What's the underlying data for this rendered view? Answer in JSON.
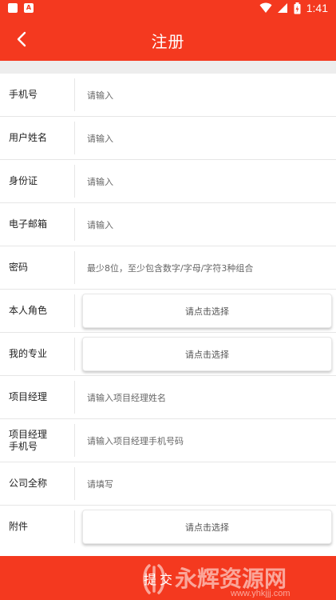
{
  "status_bar": {
    "time": "1:41",
    "left_icons": [
      "notification-icon",
      "a-icon"
    ],
    "right_icons": [
      "wifi-icon",
      "signal-icon",
      "battery-icon"
    ]
  },
  "header": {
    "title": "注册",
    "back_icon": "chevron-left-icon"
  },
  "form": {
    "rows": [
      {
        "label": "手机号",
        "type": "input",
        "placeholder": "请输入"
      },
      {
        "label": "用户姓名",
        "type": "input",
        "placeholder": "请输入"
      },
      {
        "label": "身份证",
        "type": "input",
        "placeholder": "请输入"
      },
      {
        "label": "电子邮箱",
        "type": "input",
        "placeholder": "请输入"
      },
      {
        "label": "密码",
        "type": "input",
        "placeholder": "最少8位，至少包含数字/字母/字符3种组合"
      },
      {
        "label": "本人角色",
        "type": "select",
        "placeholder": "请点击选择"
      },
      {
        "label": "我的专业",
        "type": "select",
        "placeholder": "请点击选择"
      },
      {
        "label": "项目经理",
        "type": "input",
        "placeholder": "请输入项目经理姓名"
      },
      {
        "label_line1": "项目经理",
        "label_line2": "手机号",
        "type": "input",
        "placeholder": "请输入项目经理手机号码"
      },
      {
        "label": "公司全称",
        "type": "input",
        "placeholder": "请填写"
      },
      {
        "label": "附件",
        "type": "select",
        "placeholder": "请点击选择"
      }
    ]
  },
  "footer": {
    "submit_label": "提交",
    "watermark_text": "永辉资源网",
    "watermark_url": "www.yhkjjj.com"
  },
  "colors": {
    "brand": "#f4391f",
    "background": "#ededed",
    "divider": "#e6e6e6"
  }
}
